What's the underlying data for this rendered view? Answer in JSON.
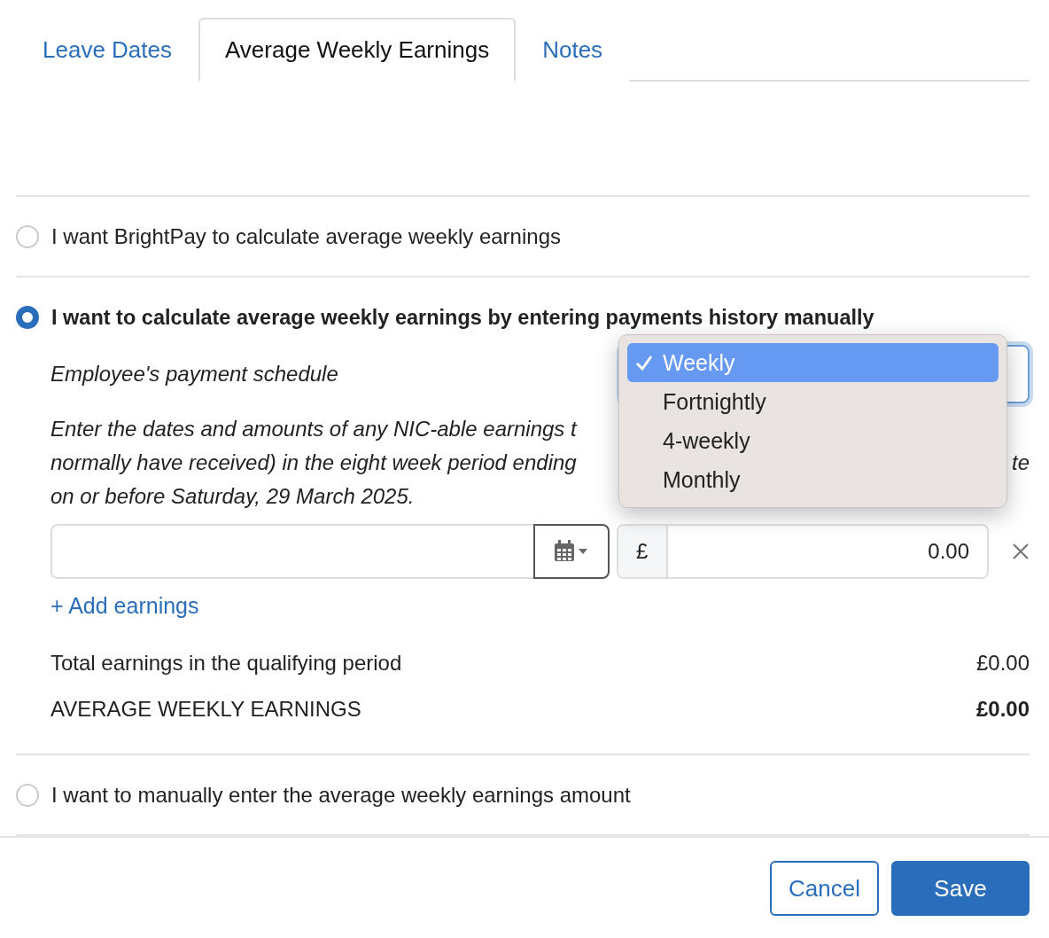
{
  "tabs": [
    {
      "label": "Leave Dates",
      "selected": false
    },
    {
      "label": "Average Weekly Earnings",
      "selected": true
    },
    {
      "label": "Notes",
      "selected": false
    }
  ],
  "calculation_options": [
    {
      "label": "I want BrightPay to calculate average weekly earnings",
      "selected": false
    },
    {
      "label": "I want to calculate average weekly earnings by entering payments history manually",
      "selected": true
    },
    {
      "label": "I want to manually enter the average weekly earnings amount",
      "selected": false
    }
  ],
  "manual_history": {
    "schedule_label": "Employee's payment schedule",
    "schedule_menu": [
      {
        "label": "Weekly",
        "selected": true
      },
      {
        "label": "Fortnightly",
        "selected": false
      },
      {
        "label": "4-weekly",
        "selected": false
      },
      {
        "label": "Monthly",
        "selected": false
      }
    ],
    "instructions": {
      "line_1": "Enter the dates and amounts of any NIC-able earnings t",
      "line_2": "normally have received) in the eight week period ending",
      "line_2_end": "te",
      "line_3": "on or before Saturday, 29 March 2025."
    },
    "earnings_rows": [
      {
        "currency": "£",
        "amount": "0.00"
      }
    ],
    "add_link": "+ Add earnings",
    "total_label": "Total earnings in the qualifying period",
    "total_value": "£0.00",
    "average_label": "AVERAGE WEEKLY EARNINGS",
    "average_value": "£0.00"
  },
  "buttons": [
    {
      "label": "Cancel",
      "kind": "secondary"
    },
    {
      "label": "Save",
      "kind": "primary"
    }
  ]
}
